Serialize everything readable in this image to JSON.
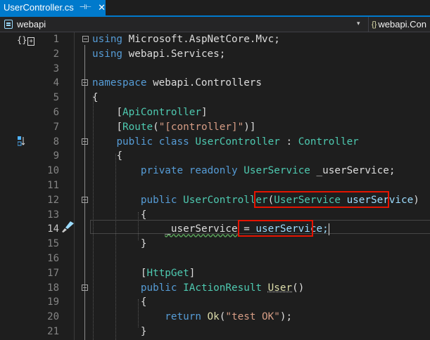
{
  "tab": {
    "title": "UserController.cs",
    "pin": "⊣⊢",
    "close": "✕"
  },
  "navbar": {
    "project": "webapi",
    "dropdown": "▾",
    "namespace": "webapi.Con"
  },
  "gutter": {
    "scope_glyph": "{}",
    "ref_glyph": "1⃣"
  },
  "editor": {
    "active_line": 14,
    "lines": [
      {
        "n": "1"
      },
      {
        "n": "2"
      },
      {
        "n": "3"
      },
      {
        "n": "4"
      },
      {
        "n": "5"
      },
      {
        "n": "6"
      },
      {
        "n": "7"
      },
      {
        "n": "8"
      },
      {
        "n": "9"
      },
      {
        "n": "10"
      },
      {
        "n": "11"
      },
      {
        "n": "12"
      },
      {
        "n": "13"
      },
      {
        "n": "14"
      },
      {
        "n": "15"
      },
      {
        "n": "16"
      },
      {
        "n": "17"
      },
      {
        "n": "18"
      },
      {
        "n": "19"
      },
      {
        "n": "20"
      },
      {
        "n": "21"
      }
    ],
    "code": {
      "l1_kw": "using",
      "l1_rest": " Microsoft.AspNetCore.Mvc;",
      "l2_kw": "using",
      "l2_rest": " webapi.Services;",
      "l4_kw": "namespace",
      "l4_rest": " webapi.Controllers",
      "l5": "{",
      "l6_open": "[",
      "l6_attr": "ApiController",
      "l6_close": "]",
      "l7_open": "[",
      "l7_attr": "Route",
      "l7_p": "(",
      "l7_str": "\"[controller]\"",
      "l7_close": ")]",
      "l8_kw1": "public",
      "l8_kw2": "class",
      "l8_name": "UserController",
      "l8_colon": " : ",
      "l8_base": "Controller",
      "l9": "{",
      "l10_kw1": "private",
      "l10_kw2": "readonly",
      "l10_type": "UserService",
      "l10_field": "_userService;",
      "l12_kw": "public",
      "l12_name": "UserController",
      "l12_p": "(",
      "l12_type": "UserService",
      "l12_param": "userService",
      "l12_close": ")",
      "l13": "{",
      "l14_field": "_userService",
      "l14_eq": " = ",
      "l14_val": "userService;",
      "l15": "}",
      "l17_open": "[",
      "l17_attr": "HttpGet",
      "l17_close": "]",
      "l18_kw": "public",
      "l18_type": "IActionResult",
      "l18_name": "User",
      "l18_p": "()",
      "l19": "{",
      "l20_kw": "return",
      "l20_call": " Ok",
      "l20_p": "(",
      "l20_str": "\"test OK\"",
      "l20_close": ");",
      "l21": "}"
    }
  },
  "colors": {
    "keyword": "#569cd6",
    "type": "#4ec9b0",
    "string": "#d69d85",
    "highlight": "#e51400",
    "tab": "#007acc"
  }
}
